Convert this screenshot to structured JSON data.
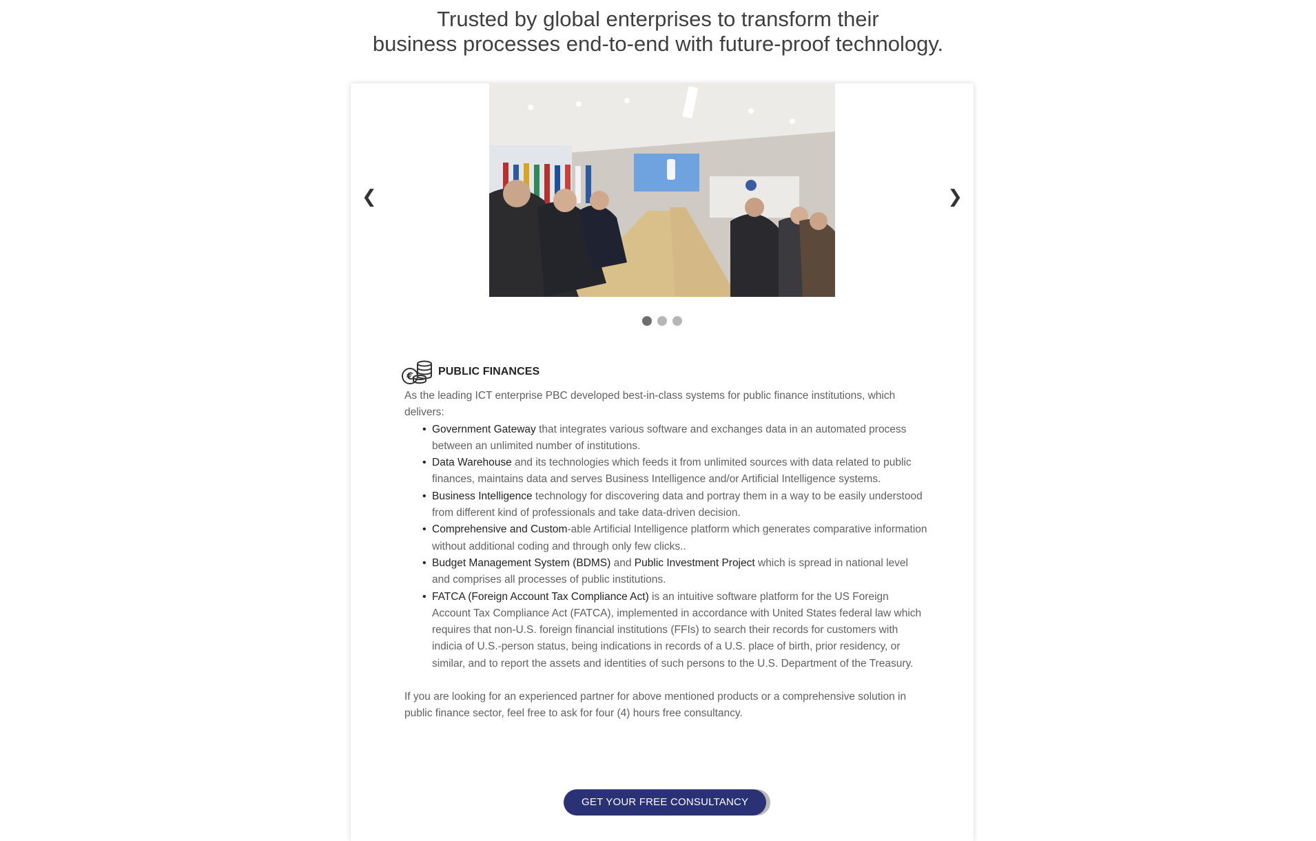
{
  "hero": {
    "line1": "Trusted by global enterprises to transform their",
    "line2": "business processes end-to-end with future-proof technology."
  },
  "carousel": {
    "prev": "❮",
    "next": "❯",
    "dot_count": 3,
    "active_index": 0
  },
  "section": {
    "icon": "coins-euro-icon",
    "title": "PUBLIC FINANCES",
    "intro": "As the leading ICT enterprise PBC developed best-in-class systems for public finance institutions, which delivers:",
    "items": [
      {
        "strong": "Government Gateway",
        "rest": " that integrates various software and exchanges data in an automated process between an unlimited number of institutions."
      },
      {
        "strong": "Data Warehouse",
        "rest": " and its technologies which feeds it from unlimited sources with data related to public finances, maintains data and serves Business Intelligence and/or Artificial Intelligence systems."
      },
      {
        "strong": "Business Intelligence",
        "rest": " technology for discovering data and portray them in a way to be easily understood from different kind of professionals and take data-driven decision."
      },
      {
        "strong": "Comprehensive and Custom",
        "rest": "-able Artificial Intelligence platform which generates comparative information without additional coding and through only few clicks.."
      },
      {
        "strong": "Budget Management System (BDMS)",
        "mid": " and ",
        "strong2": "Public Investment Project",
        "rest": " which is spread in national level and comprises all processes of public institutions."
      },
      {
        "strong": "FATCA (Foreign Account Tax Compliance Act)",
        "rest": " is an intuitive software platform for the US Foreign Account Tax Compliance Act (FATCA), implemented in accordance with United States federal law which requires that non-U.S. foreign financial institutions (FFIs) to search their records for customers with indicia of U.S.-person status, being indications in records of a U.S. place of birth, prior residency, or similar, and to report the assets and identities of such persons to the U.S. Department of the Treasury."
      }
    ],
    "closing": "If you are looking for an experienced partner for above mentioned products or a comprehensive solution in public finance sector, feel free to ask for four (4) hours free consultancy."
  },
  "cta": {
    "label": "GET YOUR FREE CONSULTANCY"
  }
}
